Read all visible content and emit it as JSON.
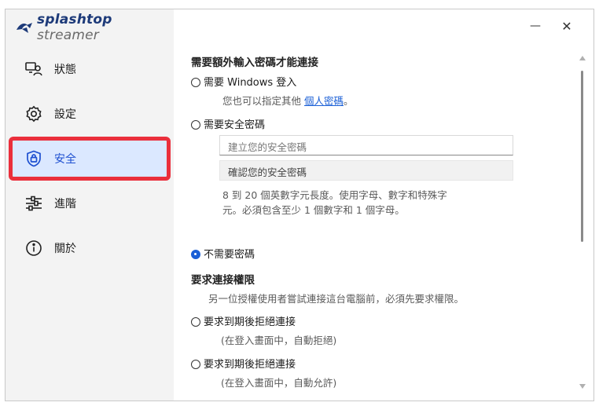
{
  "app": {
    "brand": "splashtop",
    "product": "streamer"
  },
  "window_controls": {
    "minimize": "—",
    "close": "✕"
  },
  "sidebar": {
    "items": [
      {
        "label": "狀態",
        "icon": "status-icon"
      },
      {
        "label": "設定",
        "icon": "gear-icon"
      },
      {
        "label": "安全",
        "icon": "shield-lock-icon",
        "active": true
      },
      {
        "label": "進階",
        "icon": "sliders-icon"
      },
      {
        "label": "關於",
        "icon": "info-icon"
      }
    ]
  },
  "security": {
    "password_section_title": "需要額外輸入密碼才能連接",
    "option_windows_login": "需要 Windows 登入",
    "windows_login_hint_prefix": "您也可以指定其他",
    "windows_login_hint_link": "個人密碼",
    "windows_login_hint_suffix": "。",
    "option_security_code": "需要安全密碼",
    "security_code_placeholder": "建立您的安全密碼",
    "security_code_confirm": "確認您的安全密碼",
    "security_code_rule_1": "8 到 20 個英數字元長度。使用字母、數字和特殊字",
    "security_code_rule_2": "元。必須包含至少 1 個數字和 1 個字母。",
    "option_no_password": "不需要密碼",
    "selected_option": "no_password",
    "permission_section_title": "要求連接權限",
    "permission_description": "另一位授權使用者嘗試連接這台電腦前，必須先要求權限。",
    "option_request_reject": "要求到期後拒絕連接",
    "option_request_reject_note": "(在登入畫面中，自動拒絕)",
    "option_request_allow": "要求到期後拒絕連接",
    "option_request_allow_note": "(在登入畫面中，自動允許)"
  },
  "colors": {
    "accent": "#1a5fd6",
    "highlight_box": "#ea2f3c",
    "active_bg": "#dbe8ff"
  }
}
